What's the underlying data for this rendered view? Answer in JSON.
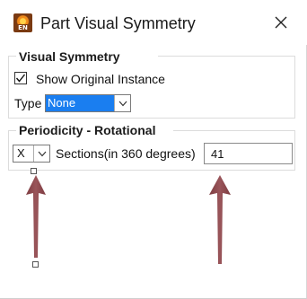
{
  "window": {
    "title": "Part Visual Symmetry",
    "icon": "ensight-app-icon",
    "icon_text": "EN"
  },
  "visual_symmetry": {
    "group_title": "Visual Symmetry",
    "show_original_label": "Show Original Instance",
    "show_original_checked": true,
    "type_label": "Type",
    "type_value": "None"
  },
  "periodicity": {
    "group_title": "Periodicity - Rotational",
    "axis_value": "X",
    "sections_label": "Sections(in 360 degrees)",
    "sections_value": "41"
  },
  "colors": {
    "selection": "#1a7ef0",
    "arrow": "#8f4a4f"
  }
}
